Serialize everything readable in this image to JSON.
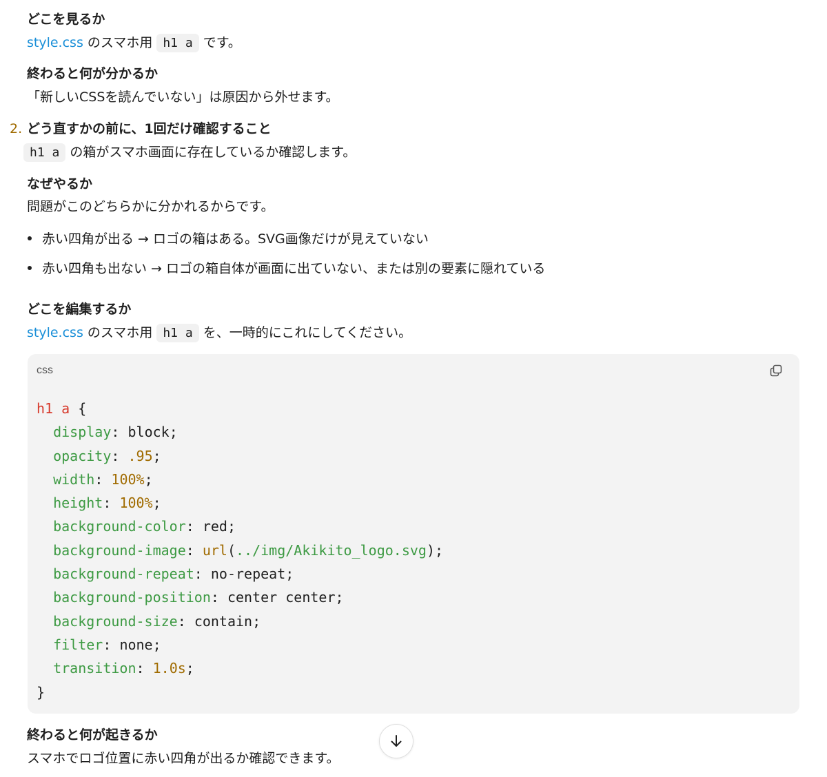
{
  "section1": {
    "where_heading": "どこを見るか",
    "where_link": "style.css",
    "where_text_a": " のスマホ用",
    "where_code": "h1 a",
    "where_text_b": "です。",
    "result_heading": "終わると何が分かるか",
    "result_text": "「新しいCSSを読んでいない」は原因から外せます。"
  },
  "step2": {
    "number": "2.",
    "title": "どう直すかの前に、1回だけ確認すること",
    "intro_code": "h1 a",
    "intro_text": "の箱がスマホ画面に存在しているか確認します。",
    "why_heading": "なぜやるか",
    "why_text": "問題がこのどちらかに分かれるからです。",
    "bullets": [
      "赤い四角が出る → ロゴの箱はある。SVG画像だけが見えていない",
      "赤い四角も出ない → ロゴの箱自体が画面に出ていない、または別の要素に隠れている"
    ],
    "edit_heading": "どこを編集するか",
    "edit_link": "style.css",
    "edit_text_a": " のスマホ用",
    "edit_code": "h1 a",
    "edit_text_b": "を、一時的にこれにしてください。"
  },
  "codeblock": {
    "language": "css",
    "copy_icon": "copy-icon",
    "selector": "h1 a",
    "open_brace": " {",
    "close_brace": "}",
    "declarations": [
      {
        "prop": "display",
        "value": "block",
        "kind": "val"
      },
      {
        "prop": "opacity",
        "value": ".95",
        "kind": "num"
      },
      {
        "prop": "width",
        "value": "100%",
        "kind": "num"
      },
      {
        "prop": "height",
        "value": "100%",
        "kind": "num"
      },
      {
        "prop": "background-color",
        "value": "red",
        "kind": "val"
      },
      {
        "prop": "background-image",
        "value": "url(../img/Akikito_logo.svg)",
        "kind": "url"
      },
      {
        "prop": "background-repeat",
        "value": "no-repeat",
        "kind": "val"
      },
      {
        "prop": "background-position",
        "value": "center center",
        "kind": "val"
      },
      {
        "prop": "background-size",
        "value": "contain",
        "kind": "val"
      },
      {
        "prop": "filter",
        "value": "none",
        "kind": "val"
      },
      {
        "prop": "transition",
        "value": "1.0s",
        "kind": "num"
      }
    ]
  },
  "section3": {
    "happen_heading": "終わると何が起きるか",
    "happen_text": "スマホでロゴ位置に赤い四角が出るか確認できます。"
  },
  "scroll_button": {
    "icon": "arrow-down-icon"
  },
  "colors": {
    "link": "#1a8fd8",
    "selector": "#d73a2c",
    "property": "#3d9a43",
    "number": "#a06b00",
    "code_bg": "#f3f3f3"
  }
}
